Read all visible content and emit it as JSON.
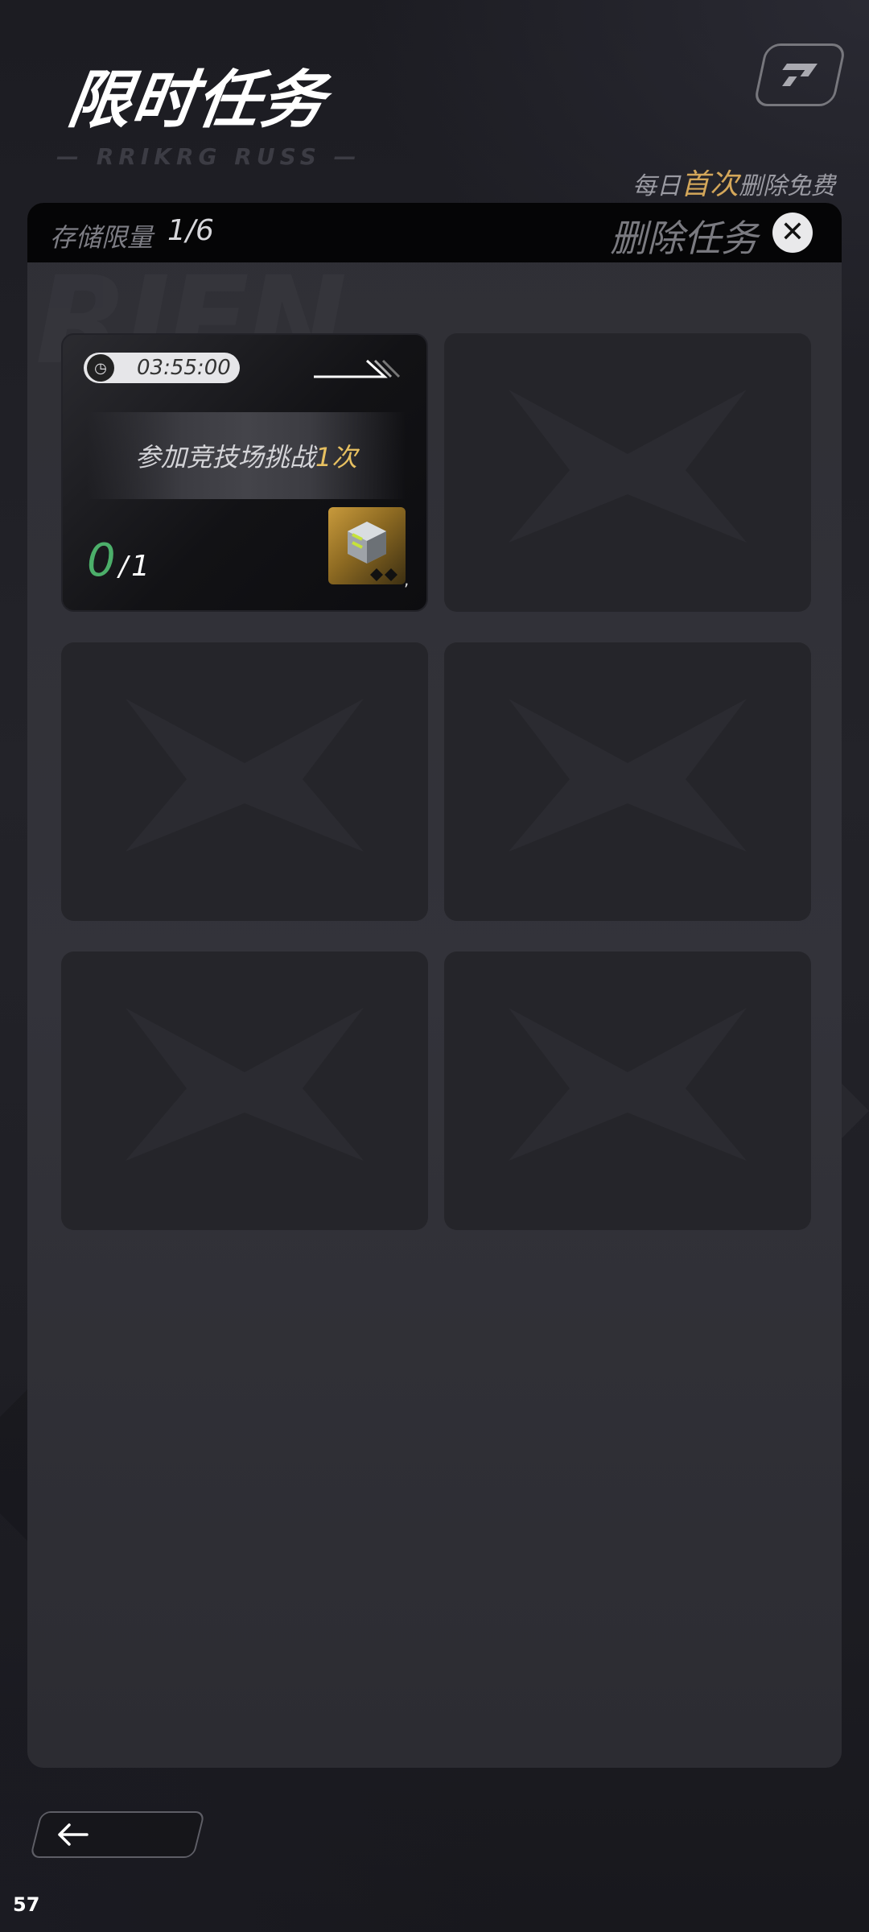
{
  "header": {
    "title": "限时任务",
    "subtitle_deco": "— RRIKRG RUSS —",
    "free_note_prefix": "每日",
    "free_note_highlight": "首次",
    "free_note_suffix": "删除免费"
  },
  "panel": {
    "storage_label": "存储限量",
    "storage_value": "1/6",
    "delete_label": "删除任务",
    "delete_icon": "close-icon",
    "watermark": "RIEN"
  },
  "tasks": [
    {
      "timer": "03:55:00",
      "description_prefix": "参加竞技场挑战",
      "description_highlight": "1次",
      "progress_current": "0",
      "progress_separator": "/",
      "progress_total": "1",
      "reward_icon": "gem-cube-icon",
      "reward_tick": ","
    }
  ],
  "empty_slots": 5,
  "footer": {
    "back_icon": "arrow-left-icon",
    "page_number": "57"
  },
  "colors": {
    "accent_gold": "#d4a75a",
    "progress_green": "#4caf6a",
    "highlight_yellow": "#e7c061"
  }
}
